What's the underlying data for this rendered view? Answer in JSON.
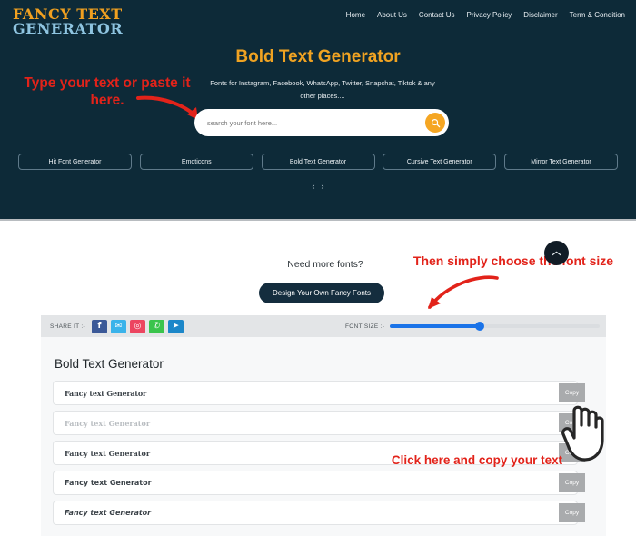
{
  "site": {
    "logo_line1": "FANCY TEXT",
    "logo_line2": "GENERATOR",
    "logo_color_1": "#f0a020",
    "logo_color_2": "#8ec4e0",
    "hero_bg": "#0d2a38",
    "accent": "#f0a322"
  },
  "nav": {
    "items": [
      {
        "label": "Home"
      },
      {
        "label": "About Us"
      },
      {
        "label": "Contact Us"
      },
      {
        "label": "Privacy Policy"
      },
      {
        "label": "Disclaimer"
      },
      {
        "label": "Term & Condition"
      }
    ]
  },
  "hero": {
    "title": "Bold Text Generator",
    "subtitle": "Fonts for Instagram, Facebook, WhatsApp, Twitter, Snapchat, Tiktok & any other places....",
    "search_placeholder": "search your font here...",
    "search_value": "",
    "search_icon": "search-icon"
  },
  "categories": [
    {
      "label": "Hit Font Generator"
    },
    {
      "label": "Emoticons"
    },
    {
      "label": "Bold Text Generator"
    },
    {
      "label": "Cursive Text Generator"
    },
    {
      "label": "Mirror Text Generator"
    }
  ],
  "carousel": {
    "prev": "‹",
    "next": "›"
  },
  "mid": {
    "need_more_fonts": "Need more fonts?",
    "design_button": "Design Your Own Fancy Fonts",
    "scroll_top_icon": "chevron-up-icon"
  },
  "annotations": {
    "left": "Type your text or paste it here.",
    "right": "Then simply choose the font size",
    "bottom": "Click here and copy your text",
    "color": "#e2231a"
  },
  "toolbar": {
    "share_label": "SHARE IT :-",
    "share_icons": [
      {
        "name": "facebook-icon",
        "glyph": "f",
        "color": "#3b5998",
        "cls": "fb"
      },
      {
        "name": "twitter-icon",
        "glyph": "✉",
        "color": "#3ab3ea",
        "cls": "tw"
      },
      {
        "name": "instagram-icon",
        "glyph": "◎",
        "color": "#ec4560",
        "cls": "ig"
      },
      {
        "name": "whatsapp-icon",
        "glyph": "✆",
        "color": "#3ac44c",
        "cls": "wa"
      },
      {
        "name": "telegram-icon",
        "glyph": "➤",
        "color": "#1c87c9",
        "cls": "tg"
      }
    ],
    "font_size_label": "FONT SIZE :-",
    "font_size_percent": 43
  },
  "results": {
    "title": "Bold Text Generator",
    "copy_label": "Copy",
    "rows": [
      {
        "text": "Fancy text Generator",
        "style": "s1"
      },
      {
        "text": "Fancy text Generator",
        "style": "s2"
      },
      {
        "text": "Fancy text Generator",
        "style": "s3"
      },
      {
        "text": "Fancy text Generator",
        "style": "s4"
      },
      {
        "text": "Fancy text Generator",
        "style": "s5"
      }
    ]
  }
}
